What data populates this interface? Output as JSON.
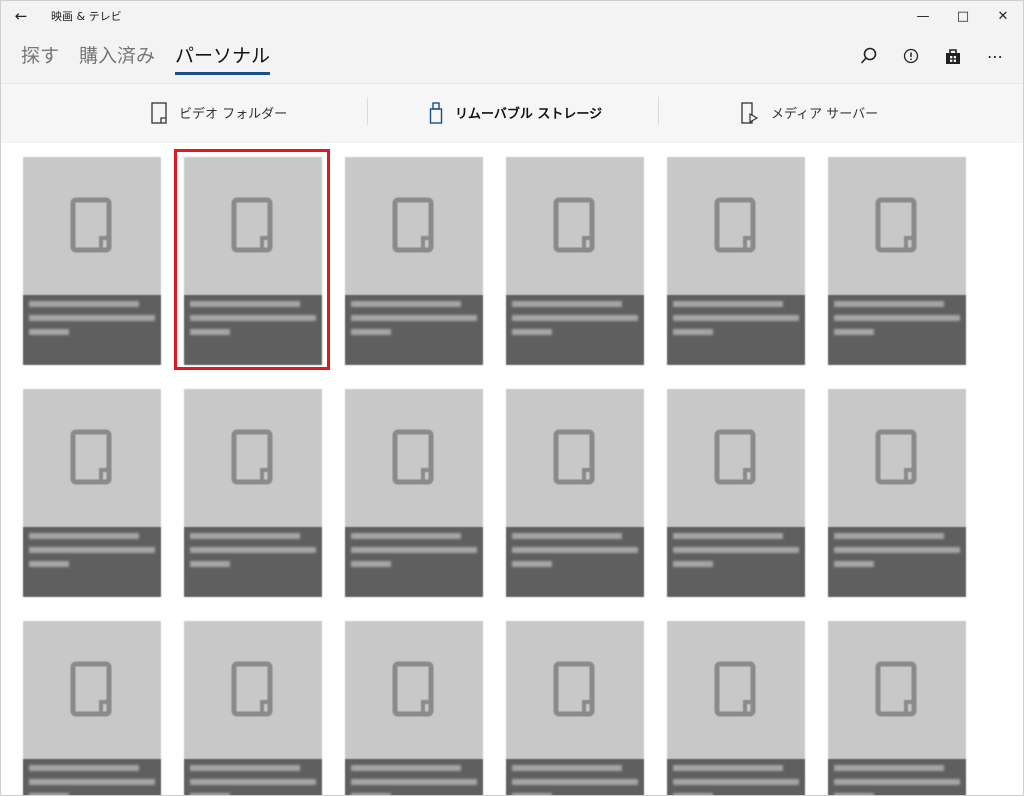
{
  "window": {
    "title": "映画 & テレビ"
  },
  "nav": {
    "tabs": [
      {
        "label": "探す"
      },
      {
        "label": "購入済み"
      },
      {
        "label": "パーソナル"
      }
    ],
    "active_tab": "パーソナル"
  },
  "sources": [
    {
      "label": "ビデオ フォルダー",
      "icon": "document-icon"
    },
    {
      "label": "リムーバブル ストレージ",
      "icon": "usb-drive-icon"
    },
    {
      "label": "メディア サーバー",
      "icon": "media-server-icon"
    }
  ],
  "tiles": {
    "rows": 3,
    "columns": 6,
    "highlighted_index": 1
  },
  "colors": {
    "accent": "#1a4f8c",
    "highlight": "#e0191f",
    "tile_bg": "#c8c8c8",
    "caption_bg": "#5f5f5f"
  }
}
